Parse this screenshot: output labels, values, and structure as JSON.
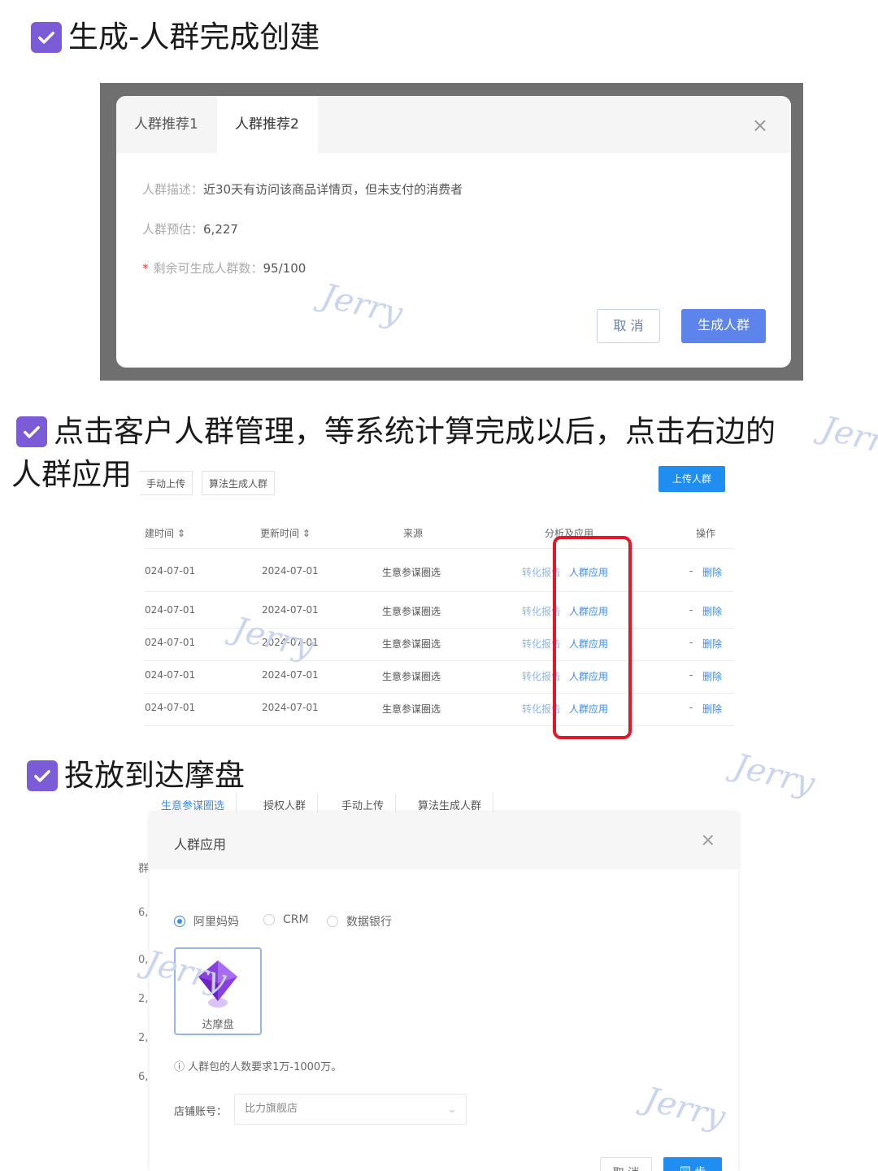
{
  "headings": {
    "step1": "生成-人群完成创建",
    "step2_line1": "点击客户人群管理，等系统计算完成以后，点击右边的",
    "step2_line2": "人群应用",
    "step3": "投放到达摩盘"
  },
  "watermark": "Jerry",
  "colors": {
    "check": "#7b5bd6",
    "primary": "#5c84ea",
    "link": "#3f8ae8",
    "highlight": "#e0192a"
  },
  "shot1": {
    "tabs": [
      "人群推荐1",
      "人群推荐2"
    ],
    "active_tab": "人群推荐2",
    "close": "×",
    "desc_label": "人群描述：",
    "desc_value": "近30天有访问该商品详情页，但未支付的消费者",
    "estimate_label": "人群预估：",
    "estimate_value": "6,227",
    "remaining_label": "剩余可生成人群数：",
    "remaining_value": "95/100",
    "required_mark": "*",
    "cancel": "取 消",
    "generate": "生成人群"
  },
  "shot2": {
    "chips": [
      "手动上传",
      "算法生成人群"
    ],
    "upload_button": "上传人群",
    "headers": [
      "建时间",
      "更新时间",
      "来源",
      "分析及应用",
      "操作"
    ],
    "sort_icon": "⇕",
    "rows": [
      {
        "created": "024-07-01",
        "updated": "2024-07-01",
        "source": "生意参谋圈选",
        "analysis": "转化报告",
        "apply": "人群应用",
        "dash": "-",
        "delete": "删除"
      },
      {
        "created": "024-07-01",
        "updated": "2024-07-01",
        "source": "生意参谋圈选",
        "analysis": "转化报告",
        "apply": "人群应用",
        "dash": "-",
        "delete": "删除"
      },
      {
        "created": "024-07-01",
        "updated": "2024-07-01",
        "source": "生意参谋圈选",
        "analysis": "转化报告",
        "apply": "人群应用",
        "dash": "-",
        "delete": "删除"
      },
      {
        "created": "024-07-01",
        "updated": "2024-07-01",
        "source": "生意参谋圈选",
        "analysis": "转化报告",
        "apply": "人群应用",
        "dash": "-",
        "delete": "删除"
      },
      {
        "created": "024-07-01",
        "updated": "2024-07-01",
        "source": "生意参谋圈选",
        "analysis": "转化报告",
        "apply": "人群应用",
        "dash": "-",
        "delete": "删除"
      }
    ]
  },
  "shot3": {
    "top_tabs": [
      "生意参谋圈选",
      "授权人群",
      "手动上传",
      "算法生成人群"
    ],
    "active_top_tab": "生意参谋圈选",
    "bg_rows": [
      "群",
      "6,",
      "0,",
      "2,",
      "2,",
      "6,"
    ],
    "title": "人群应用",
    "close": "×",
    "radios": [
      "阿里妈妈",
      "CRM",
      "数据银行"
    ],
    "selected_radio": "阿里妈妈",
    "card_label": "达摩盘",
    "note_icon": "ⓘ",
    "note": "人群包的人数要求1万-1000万。",
    "store_label": "店铺账号：",
    "store_value": "比力旗舰店",
    "select_chevron": "⌄",
    "cancel": "取 消",
    "sync": "同 步"
  }
}
